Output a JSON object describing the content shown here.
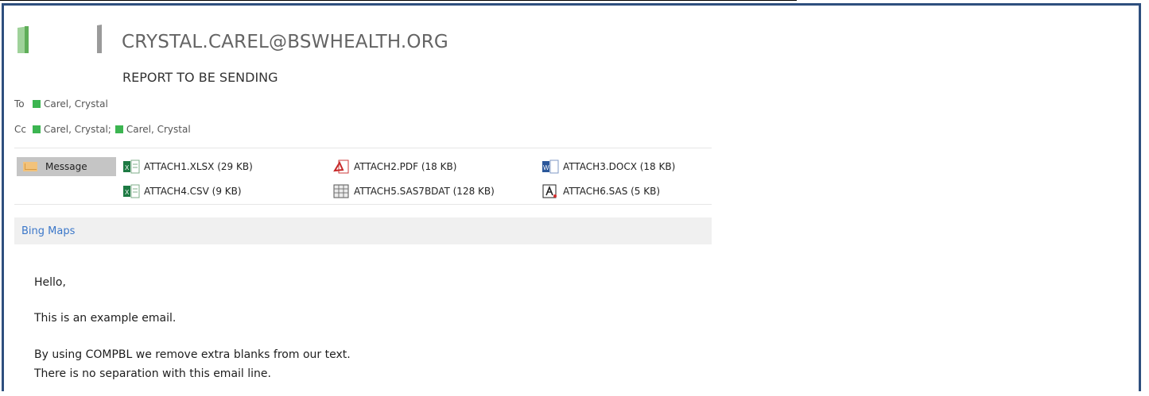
{
  "email": {
    "sender": "CRYSTAL.CAREL@BSWHEALTH.ORG",
    "subject": "REPORT TO BE SENDING"
  },
  "recipients": {
    "to_label": "To",
    "to_value": "Carel, Crystal",
    "cc_label": "Cc",
    "cc_values": [
      "Carel, Crystal;",
      "Carel, Crystal"
    ]
  },
  "tabs": {
    "message_label": "Message"
  },
  "attachments": [
    {
      "name": "ATTACH1.XLSX (29 KB)",
      "icon": "excel-icon",
      "color": "#1d7a43"
    },
    {
      "name": "ATTACH2.PDF (18 KB)",
      "icon": "pdf-icon",
      "color": "#c62828"
    },
    {
      "name": "ATTACH3.DOCX (18 KB)",
      "icon": "word-icon",
      "color": "#2b579a"
    },
    {
      "name": "ATTACH4.CSV (9 KB)",
      "icon": "csv-icon",
      "color": "#1d7a43"
    },
    {
      "name": "ATTACH5.SAS7BDAT (128 KB)",
      "icon": "sas-data-icon",
      "color": "#555555"
    },
    {
      "name": "ATTACH6.SAS (5 KB)",
      "icon": "sas-program-icon",
      "color": "#333333"
    }
  ],
  "addins": {
    "bing_maps": "Bing Maps"
  },
  "body": {
    "greeting": "Hello,",
    "line1": "This is an example email.",
    "line2": "By using COMPBL we remove extra blanks from our text.",
    "line3": "There is no separation with this email line."
  },
  "colors": {
    "frame": "#2e4f7e",
    "contact_status": "#3cb551",
    "link": "#3b77c9"
  }
}
